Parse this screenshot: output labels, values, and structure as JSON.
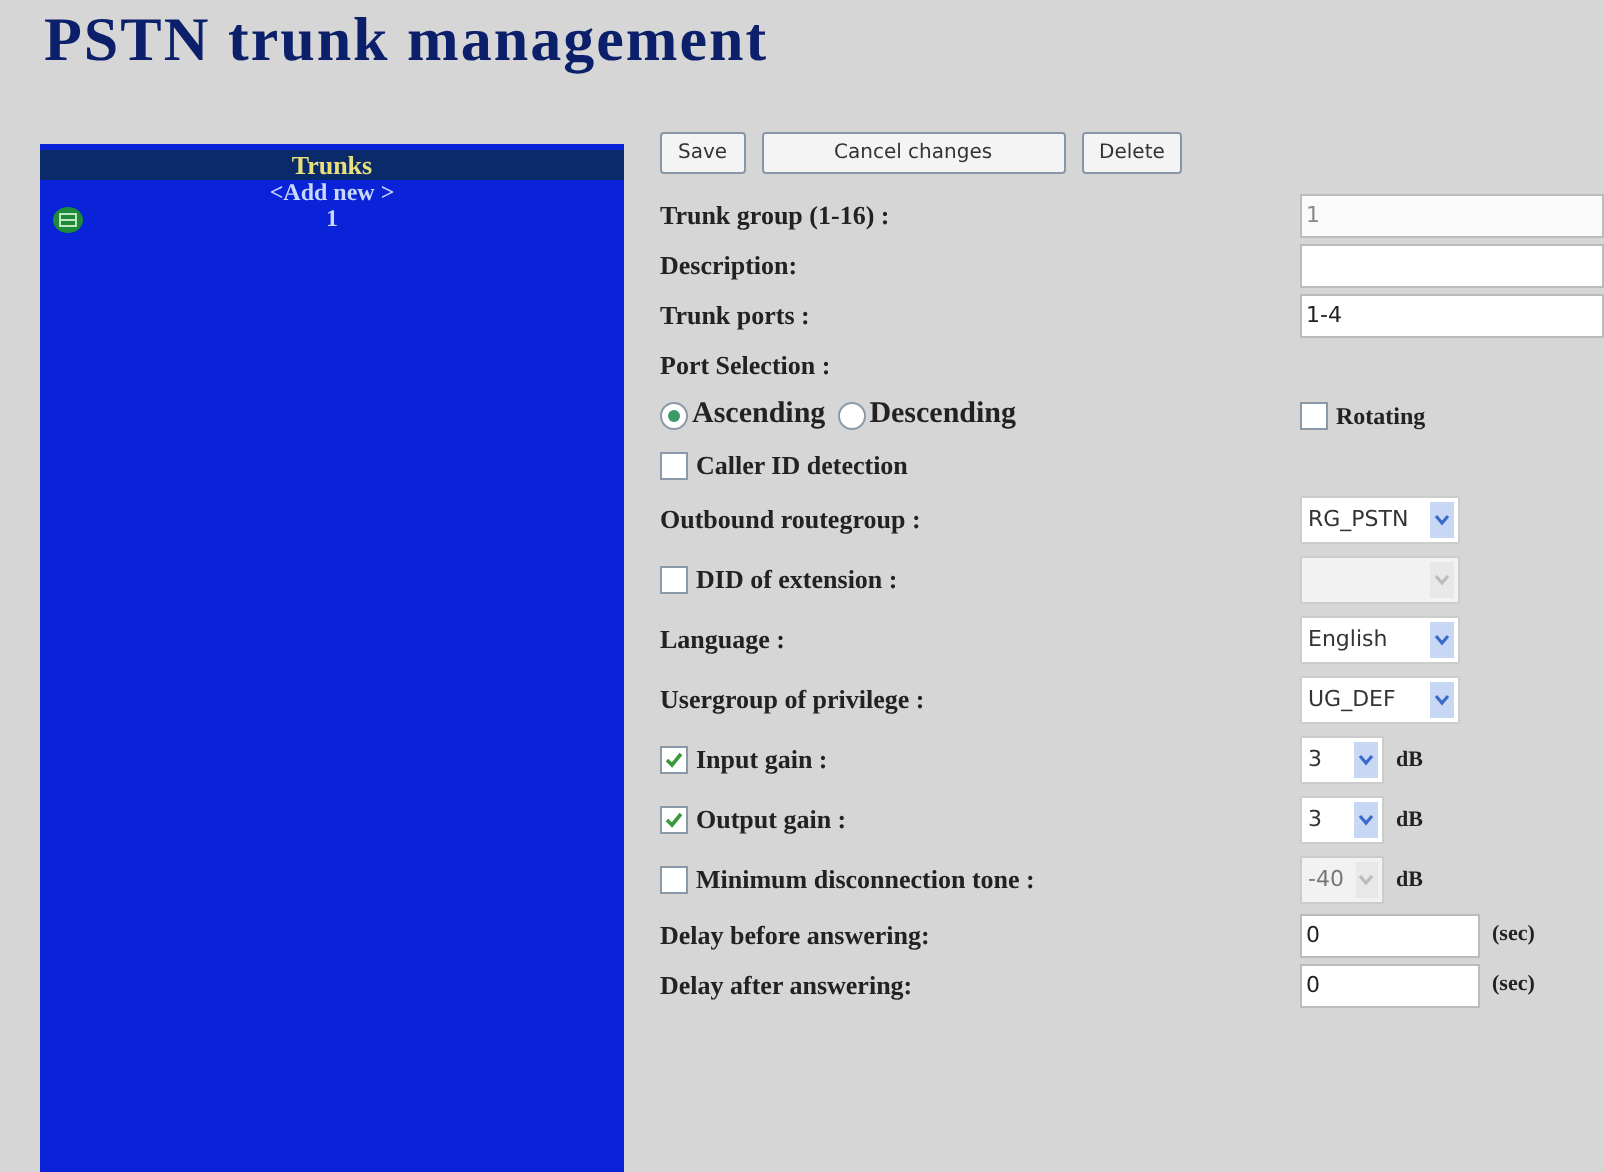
{
  "title": "PSTN trunk management",
  "sidebar": {
    "header": "Trunks",
    "items": [
      {
        "label": "<Add new >",
        "icon": false
      },
      {
        "label": "1",
        "icon": true
      }
    ]
  },
  "buttons": [
    "Save",
    "Cancel changes",
    "Delete"
  ],
  "rows": [
    {
      "kind": "text",
      "label": "Trunk group (1-16) :",
      "value": "1",
      "disabled": true
    },
    {
      "kind": "text",
      "label": "Description:"
    },
    {
      "kind": "text",
      "label": "Trunk ports :",
      "value": "1-4"
    },
    {
      "kind": "heading",
      "label": "Port Selection :"
    },
    {
      "kind": "radio",
      "options": [
        {
          "label": "Ascending",
          "selected": true
        },
        {
          "label": "Descending",
          "selected": false
        }
      ],
      "extra": {
        "label": "Rotating",
        "checked": false
      }
    },
    {
      "kind": "check",
      "label": "Caller ID detection",
      "checked": false
    },
    {
      "kind": "select",
      "label": "Outbound routegroup :",
      "value": "RG_PSTN"
    },
    {
      "kind": "select",
      "label": "DID of extension :",
      "checked": false,
      "disabled": true
    },
    {
      "kind": "select",
      "label": "Language :",
      "value": "English"
    },
    {
      "kind": "select",
      "label": "Usergroup of privilege :",
      "value": "UG_DEF"
    },
    {
      "kind": "select",
      "label": "Input gain :",
      "checked": true,
      "value": "3",
      "unit": "dB"
    },
    {
      "kind": "select",
      "label": "Output gain :",
      "checked": true,
      "value": "3",
      "unit": "dB"
    },
    {
      "kind": "select",
      "label": "Minimum disconnection tone :",
      "checked": false,
      "value": "-40",
      "disabled": true,
      "unit": "dB"
    },
    {
      "kind": "text",
      "label": "Delay before answering:",
      "value": "0",
      "unit": "(sec)"
    },
    {
      "kind": "text",
      "label": "Delay after answering:",
      "value": "0",
      "unit": "(sec)"
    }
  ]
}
